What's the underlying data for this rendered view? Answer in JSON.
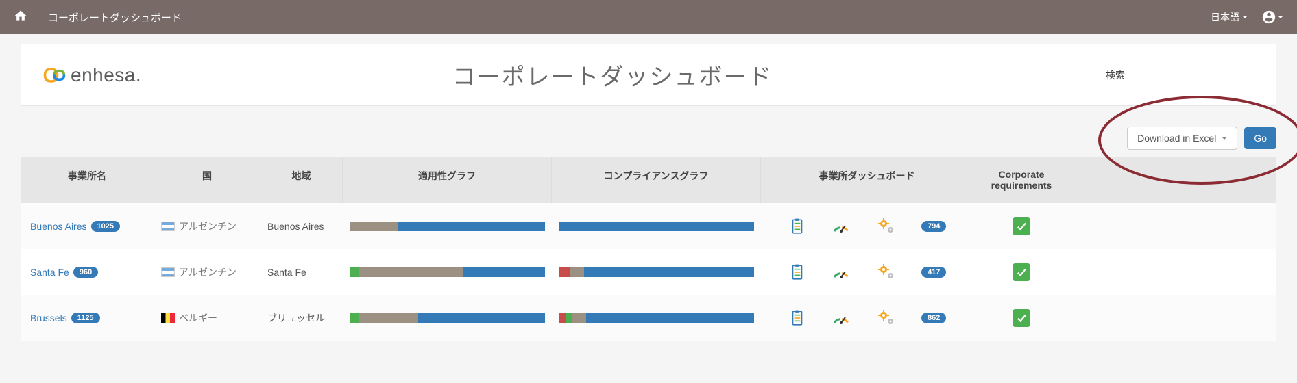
{
  "nav": {
    "title": "コーポレートダッシュボード",
    "language": "日本語"
  },
  "header": {
    "logo_text": "enhesa.",
    "page_title": "コーポレートダッシュボード",
    "search_label": "検索"
  },
  "toolbar": {
    "download_label": "Download in Excel",
    "go_label": "Go"
  },
  "table": {
    "headers": {
      "site": "事業所名",
      "country": "国",
      "region": "地域",
      "applicability": "適用性グラフ",
      "compliance": "コンプライアンスグラフ",
      "dashboard": "事業所ダッシュボード",
      "corporate": "Corporate requirements"
    },
    "rows": [
      {
        "site": "Buenos Aires",
        "count": "1025",
        "country": "アルゼンチン",
        "flag": "ar",
        "region": "Buenos Aires",
        "applicability_segments": [
          {
            "color": "#9b9082",
            "pct": 25
          },
          {
            "color": "#337ab7",
            "pct": 75
          }
        ],
        "compliance_segments": [
          {
            "color": "#337ab7",
            "pct": 100
          }
        ],
        "dash_count": "794",
        "corporate_check": true
      },
      {
        "site": "Santa Fe",
        "count": "960",
        "country": "アルゼンチン",
        "flag": "ar",
        "region": "Santa Fe",
        "applicability_segments": [
          {
            "color": "#4CAF50",
            "pct": 5
          },
          {
            "color": "#9b9082",
            "pct": 53
          },
          {
            "color": "#337ab7",
            "pct": 42
          }
        ],
        "compliance_segments": [
          {
            "color": "#c94c4c",
            "pct": 6
          },
          {
            "color": "#9b9082",
            "pct": 7
          },
          {
            "color": "#337ab7",
            "pct": 87
          }
        ],
        "dash_count": "417",
        "corporate_check": true
      },
      {
        "site": "Brussels",
        "count": "1125",
        "country": "ベルギー",
        "flag": "be",
        "region": "ブリュッセル",
        "applicability_segments": [
          {
            "color": "#4CAF50",
            "pct": 5
          },
          {
            "color": "#9b9082",
            "pct": 30
          },
          {
            "color": "#337ab7",
            "pct": 65
          }
        ],
        "compliance_segments": [
          {
            "color": "#c94c4c",
            "pct": 4
          },
          {
            "color": "#4CAF50",
            "pct": 3
          },
          {
            "color": "#9b9082",
            "pct": 7
          },
          {
            "color": "#337ab7",
            "pct": 86
          }
        ],
        "dash_count": "862",
        "corporate_check": true
      }
    ]
  },
  "colors": {
    "brand_nav": "#786a66",
    "primary": "#337ab7",
    "success": "#4CAF50",
    "annotation": "#8b2b34"
  }
}
